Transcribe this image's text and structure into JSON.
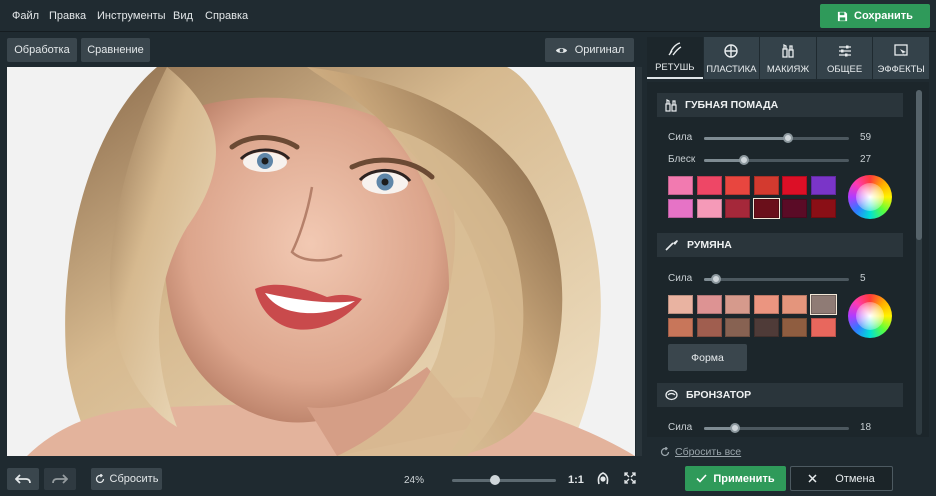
{
  "menu": {
    "file": "Файл",
    "edit": "Правка",
    "tools": "Инструменты",
    "view": "Вид",
    "help": "Справка"
  },
  "save_label": "Сохранить",
  "toolbar": {
    "processing": "Обработка",
    "compare": "Сравнение",
    "original": "Оригинал"
  },
  "bottom": {
    "reset": "Сбросить",
    "zoom": "24%",
    "ratio": "1:1"
  },
  "tabs": [
    {
      "label": "РЕТУШЬ",
      "icon": "brush-face-icon",
      "active": true
    },
    {
      "label": "ПЛАСТИКА",
      "icon": "target-icon",
      "active": false
    },
    {
      "label": "МАКИЯЖ",
      "icon": "cosmetics-icon",
      "active": false
    },
    {
      "label": "ОБЩЕЕ",
      "icon": "sliders-icon",
      "active": false
    },
    {
      "label": "ЭФФЕКТЫ",
      "icon": "effects-icon",
      "active": false
    }
  ],
  "lipstick": {
    "title": "ГУБНАЯ ПОМАДА",
    "strength_label": "Сила",
    "strength": "59",
    "gloss_label": "Блеск",
    "gloss": "27",
    "colors": [
      "#f27ab0",
      "#ee4766",
      "#e8463f",
      "#d33a2f",
      "#dc0f26",
      "#7a35c8",
      "#e673c6",
      "#f59ab8",
      "#a5283a",
      "#6a0f1a",
      "#5a0b26",
      "#8a0f16"
    ]
  },
  "blush": {
    "title": "РУМЯНА",
    "strength_label": "Сила",
    "strength": "5",
    "colors": [
      "#e9b3a1",
      "#dd9393",
      "#d69a8c",
      "#eb9580",
      "#e4957c",
      "#8f7b75",
      "#c8765a",
      "#a05e4f",
      "#876252",
      "#4f3b38",
      "#8f5d40",
      "#e8675d"
    ],
    "shape_button": "Форма"
  },
  "bronzer": {
    "title": "БРОНЗАТОР",
    "strength_label": "Сила",
    "strength": "18"
  },
  "reset_all": "Сбросить все",
  "apply": "Применить",
  "cancel": "Отмена",
  "colors": {
    "accent_green": "#2f9a5a",
    "panel": "#1c262b"
  }
}
